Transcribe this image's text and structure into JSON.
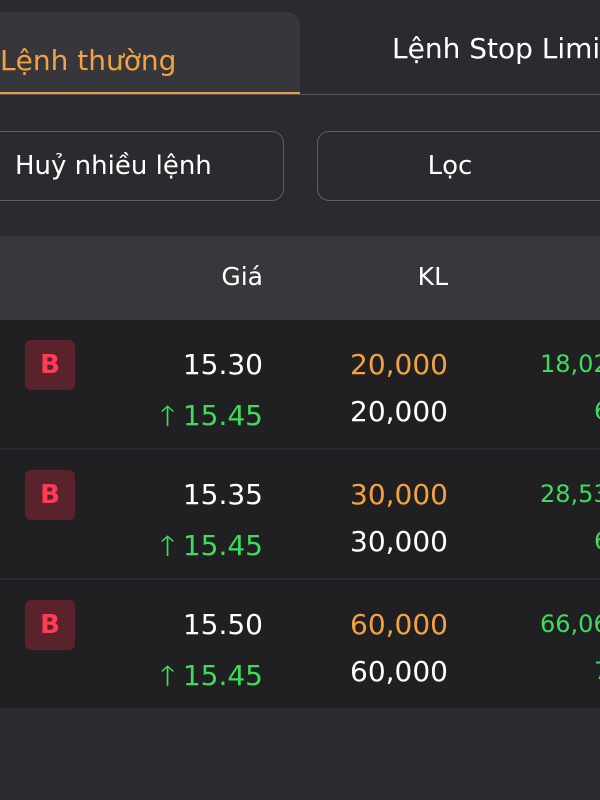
{
  "tabs": [
    {
      "label": "Lệnh thường",
      "active": true
    },
    {
      "label": "Lệnh Stop Limi",
      "active": false
    }
  ],
  "actions": {
    "cancel_multiple": "Huỷ nhiều lệnh",
    "filter": "Lọc"
  },
  "table": {
    "headers": {
      "price": "Giá",
      "volume": "KL"
    },
    "rows": [
      {
        "side": "B",
        "price": "15.30",
        "last_price": "15.45",
        "order_volume": "20,000",
        "matched_volume": "20,000",
        "value": "18,02",
        "value_line2": "6"
      },
      {
        "side": "B",
        "price": "15.35",
        "last_price": "15.45",
        "order_volume": "30,000",
        "matched_volume": "30,000",
        "value": "28,53",
        "value_line2": "6"
      },
      {
        "side": "B",
        "price": "15.50",
        "last_price": "15.45",
        "order_volume": "60,000",
        "matched_volume": "60,000",
        "value": "66,06",
        "value_line2": "7"
      }
    ]
  },
  "colors": {
    "accent": "#f2a240",
    "up": "#3ddc5a",
    "buy": "#ff3b55",
    "background": "#2b2b2f"
  },
  "icons": {
    "up_arrow": "arrow-up-icon"
  }
}
